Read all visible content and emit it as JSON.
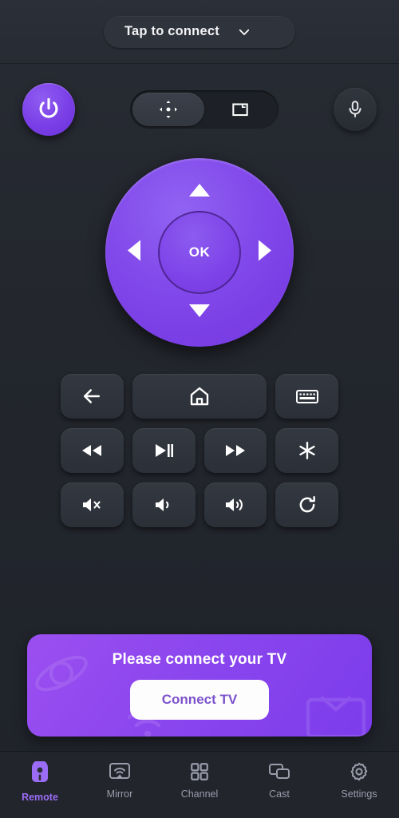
{
  "header": {
    "connect_label": "Tap to connect",
    "chevron_icon": "chevron-down-icon"
  },
  "top_row": {
    "power": {
      "icon": "power-icon",
      "color": "#7f45e9"
    },
    "mode_toggle": {
      "selected": "dpad",
      "options": [
        {
          "id": "dpad",
          "icon": "dpad-arrows-icon",
          "selected": true
        },
        {
          "id": "touchpad",
          "icon": "screen-icon",
          "selected": false
        }
      ]
    },
    "mic": {
      "icon": "microphone-icon"
    }
  },
  "dpad": {
    "ok_label": "OK",
    "up_icon": "arrow-up-icon",
    "down_icon": "arrow-down-icon",
    "left_icon": "arrow-left-icon",
    "right_icon": "arrow-right-icon",
    "color": "#8148ea"
  },
  "buttons": [
    {
      "id": "back",
      "icon": "back-arrow-icon",
      "span": 1
    },
    {
      "id": "home",
      "icon": "home-icon",
      "span": 2
    },
    {
      "id": "keyboard",
      "icon": "keyboard-icon",
      "span": 1
    },
    {
      "id": "rewind",
      "icon": "rewind-icon",
      "span": 1
    },
    {
      "id": "play-pause",
      "icon": "play-pause-icon",
      "span": 1
    },
    {
      "id": "fast-forward",
      "icon": "fast-forward-icon",
      "span": 1
    },
    {
      "id": "star",
      "icon": "asterisk-icon",
      "span": 1
    },
    {
      "id": "mute",
      "icon": "volume-mute-icon",
      "span": 1
    },
    {
      "id": "volume-down",
      "icon": "volume-down-icon",
      "span": 1
    },
    {
      "id": "volume-up",
      "icon": "volume-up-icon",
      "span": 1
    },
    {
      "id": "replay",
      "icon": "refresh-icon",
      "span": 1
    }
  ],
  "banner": {
    "title": "Please connect your TV",
    "button_label": "Connect TV",
    "gradient_from": "#9b4ff0",
    "gradient_to": "#7c3ceb",
    "button_text_color": "#7b52cc"
  },
  "bottom_nav": {
    "active": "Remote",
    "accent": "#9b6cf5",
    "items": [
      {
        "label": "Remote",
        "icon": "remote-icon",
        "active": true
      },
      {
        "label": "Mirror",
        "icon": "mirror-icon",
        "active": false
      },
      {
        "label": "Channel",
        "icon": "grid-icon",
        "active": false
      },
      {
        "label": "Cast",
        "icon": "cast-icon",
        "active": false
      },
      {
        "label": "Settings",
        "icon": "gear-icon",
        "active": false
      }
    ]
  }
}
